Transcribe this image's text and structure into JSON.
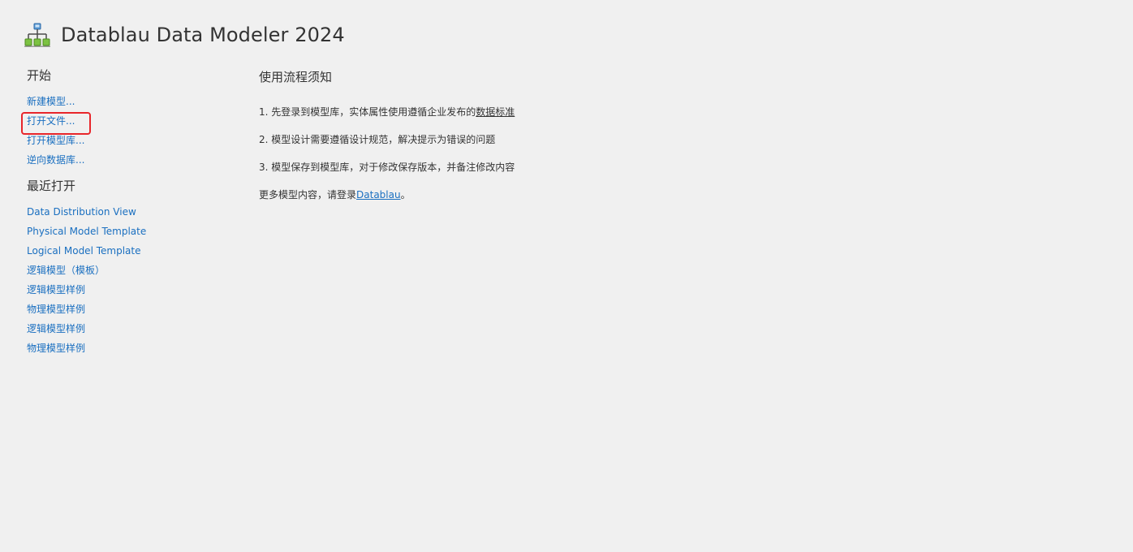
{
  "header": {
    "title": "Datablau Data Modeler 2024"
  },
  "start": {
    "title": "开始",
    "links": [
      "新建模型...",
      "打开文件...",
      "打开模型库...",
      "逆向数据库..."
    ]
  },
  "recent": {
    "title": "最近打开",
    "items": [
      "Data Distribution View",
      "Physical Model Template",
      "Logical Model Template",
      "逻辑模型（模板）",
      "逻辑模型样例",
      "物理模型样例",
      "逻辑模型样例",
      "物理模型样例"
    ]
  },
  "guide": {
    "title": "使用流程须知",
    "step1_text": "1. 先登录到模型库，实体属性使用遵循企业发布的",
    "step1_link": "数据标准",
    "step2": "2. 模型设计需要遵循设计规范，解决提示为错误的问题",
    "step3": "3. 模型保存到模型库，对于修改保存版本，并备注修改内容",
    "more_text": "更多模型内容，请登录",
    "more_link": "Datablau",
    "more_suffix": "。"
  },
  "colors": {
    "link": "#1a6fc0",
    "highlight": "#e8262b",
    "background": "#f0f0f0"
  },
  "icons": {
    "app_logo": "network-hierarchy-icon"
  }
}
